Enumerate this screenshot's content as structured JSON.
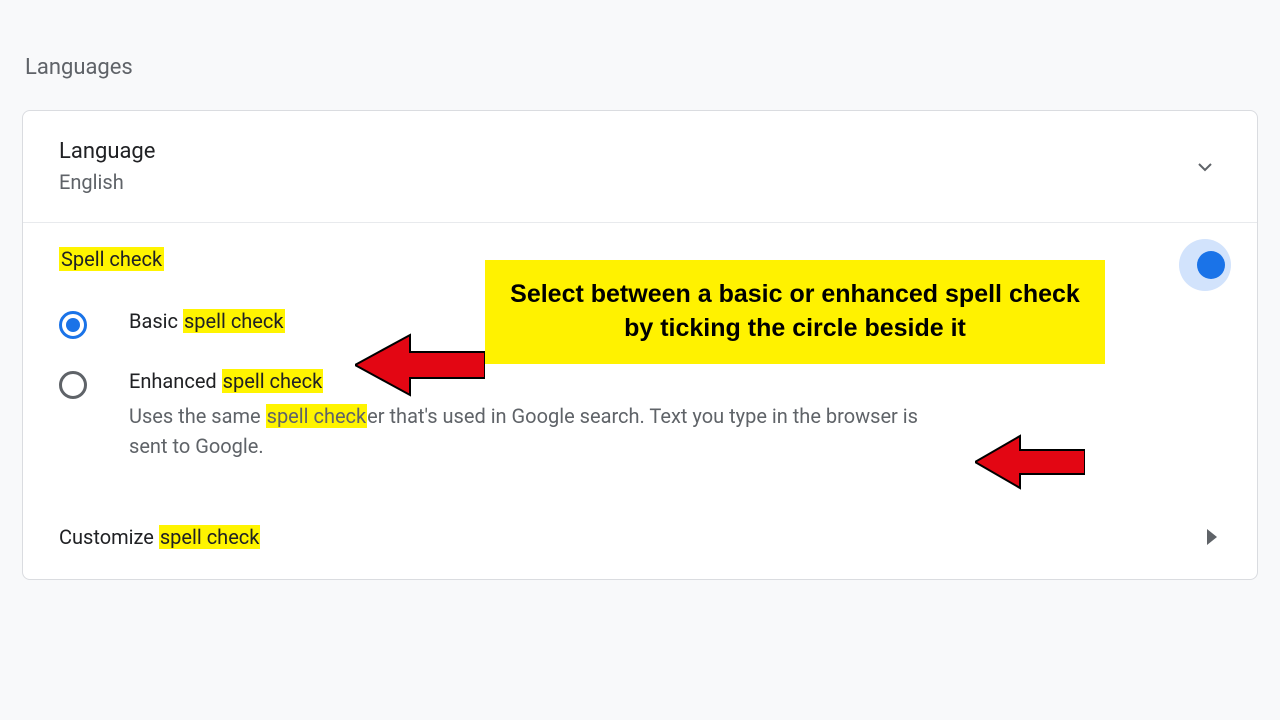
{
  "page": {
    "title": "Languages"
  },
  "language_row": {
    "label": "Language",
    "value": "English"
  },
  "spellcheck": {
    "header_prefix": "",
    "header_hl": "Spell check",
    "toggle_on": true,
    "options": {
      "basic": {
        "selected": true,
        "label_prefix": "Basic ",
        "label_hl": "spell check"
      },
      "enhanced": {
        "selected": false,
        "label_prefix": "Enhanced ",
        "label_hl": "spell check",
        "desc_prefix": "Uses the same ",
        "desc_hl": "spell check",
        "desc_suffix": "er that's used in Google search. Text you type in the browser is sent to Google."
      }
    },
    "customize": {
      "prefix": "Customize ",
      "hl": "spell check"
    }
  },
  "annotation": {
    "text": "Select between a basic or enhanced spell check by ticking the circle beside it"
  }
}
